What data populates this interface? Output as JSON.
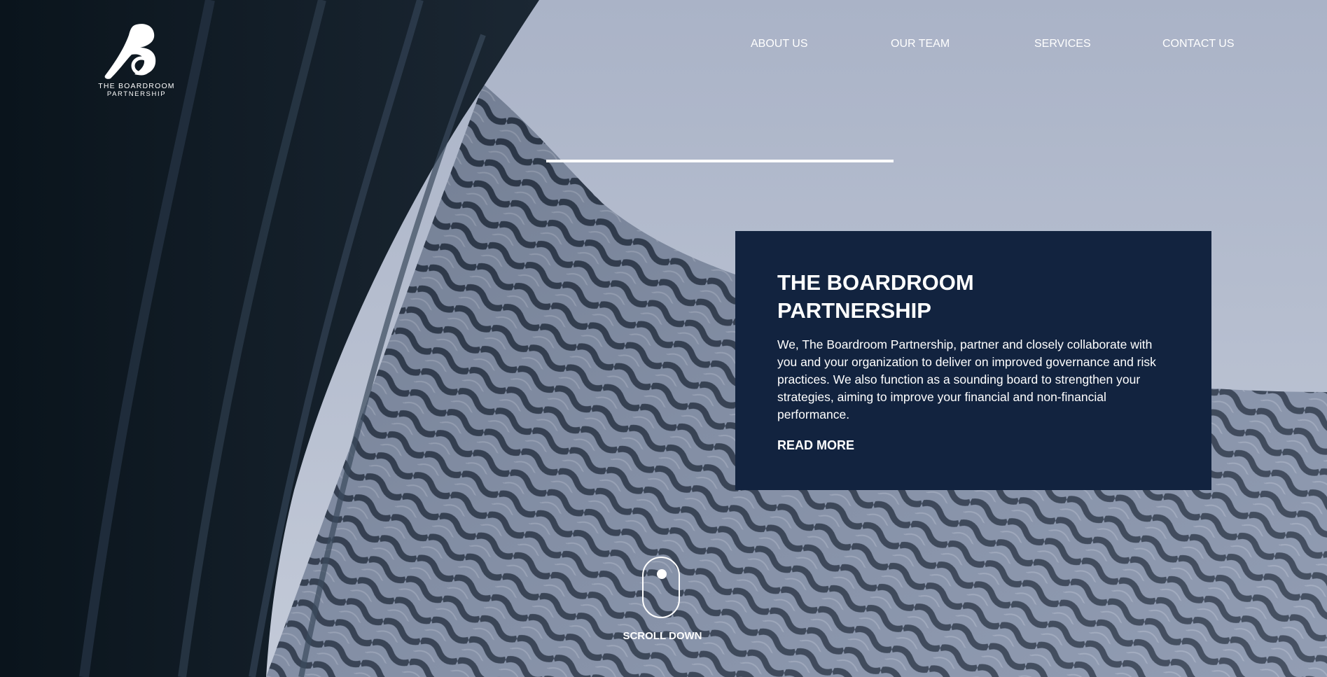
{
  "colors": {
    "card_background": "#12233f",
    "text": "#ffffff",
    "sky": "#b3bccd",
    "dark_structure": "#0f1a24",
    "facade_light": "#8f9ab0",
    "facade_shadow": "#1f2a3a"
  },
  "logo": {
    "line1": "THE BOARDROOM",
    "line2": "PARTNERSHIP"
  },
  "nav": {
    "items": [
      {
        "label": "ABOUT US"
      },
      {
        "label": "OUR TEAM"
      },
      {
        "label": "SERVICES"
      },
      {
        "label": "CONTACT US"
      }
    ]
  },
  "card": {
    "title_line1": "THE BOARDROOM",
    "title_line2": "PARTNERSHIP",
    "text": "We, The Boardroom Partnership, partner and closely collaborate with you and your organization to deliver on improved governance and risk practices. We also function as a sounding board to strengthen your strategies, aiming to improve your financial and non-financial performance.",
    "link": "READ MORE"
  },
  "scroll": {
    "label": "SCROLL DOWN"
  }
}
